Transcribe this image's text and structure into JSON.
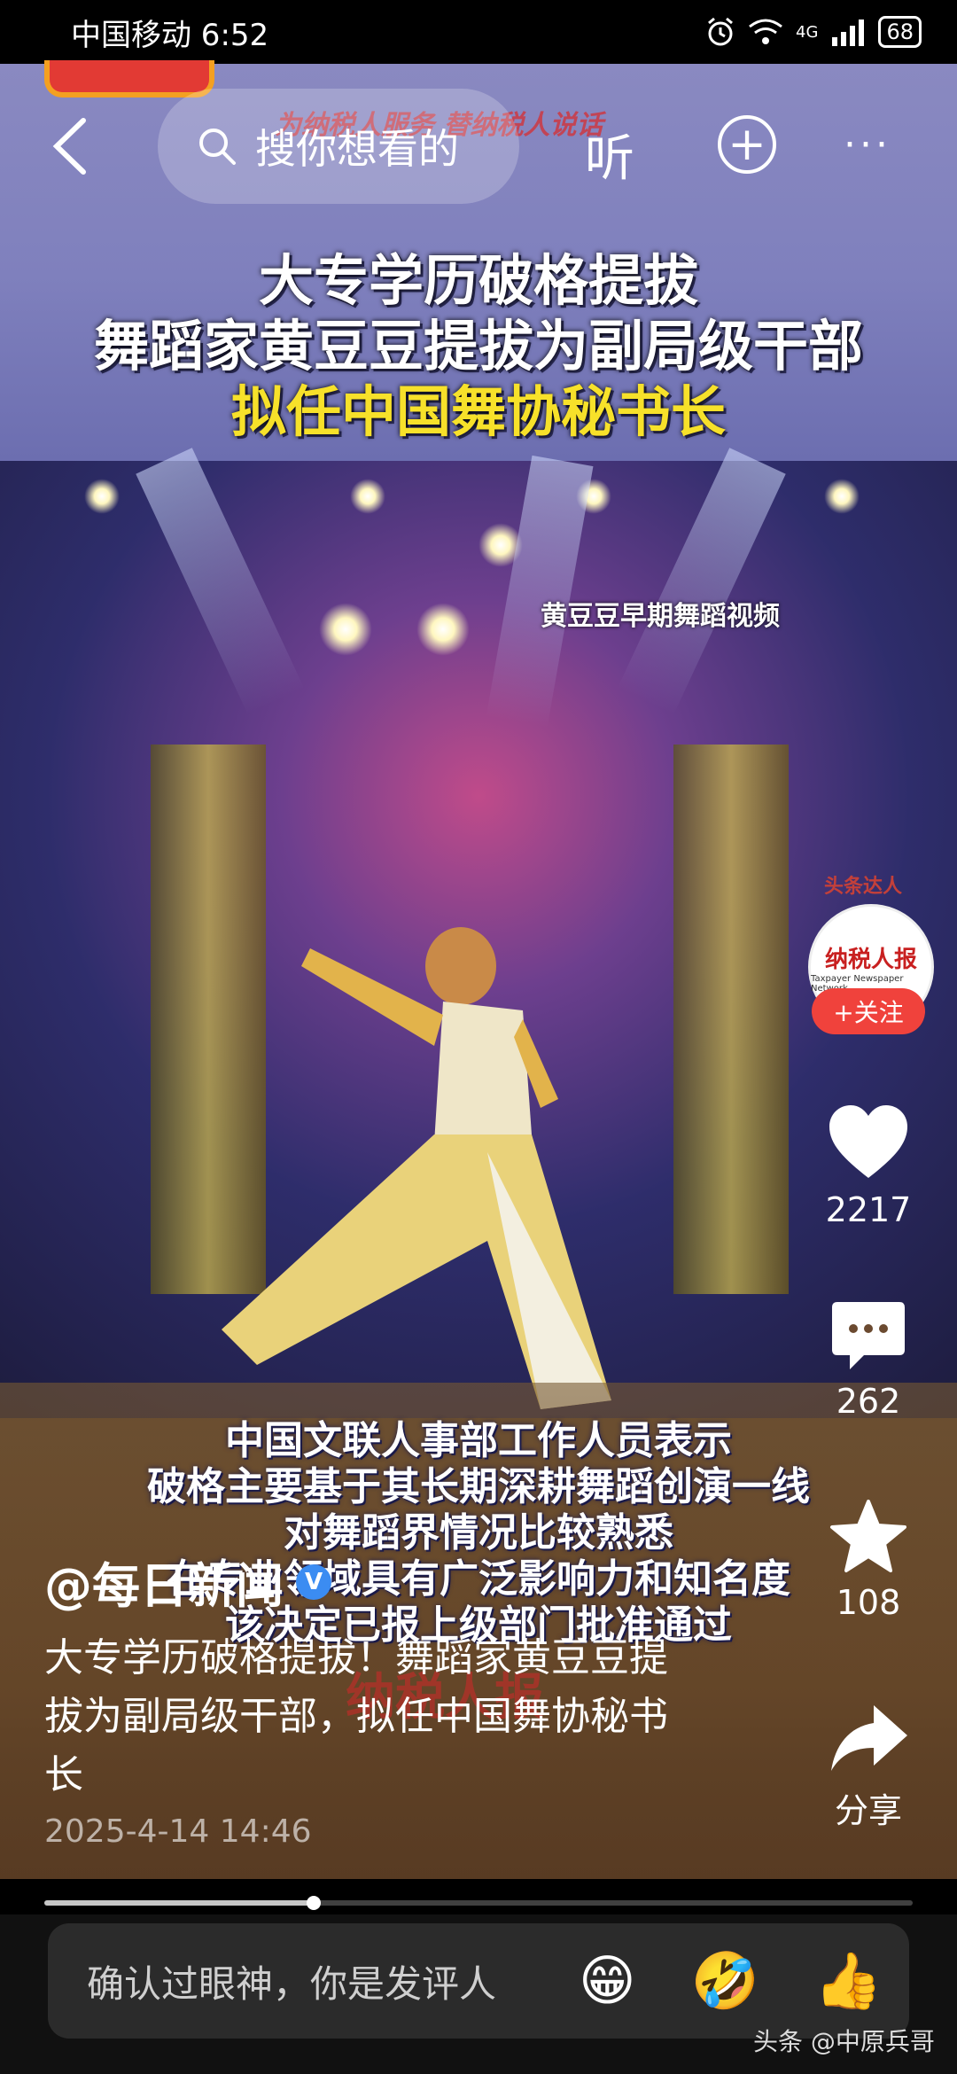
{
  "status_bar": {
    "carrier_time": "中国移动 6:52",
    "network": "4G",
    "battery": "68"
  },
  "top_nav": {
    "search_placeholder": "搜你想看的",
    "listen_label": "听",
    "plus_label": "+",
    "more_label": "···",
    "watermark": "为纳税人服务  替纳税人说话"
  },
  "video": {
    "headline": [
      "大专学历破格提拔",
      "舞蹈家黄豆豆提拔为副局级干部",
      "拟任中国舞协秘书长"
    ],
    "clip_note": "黄豆豆早期舞蹈视频",
    "subtitles": [
      "中国文联人事部工作人员表示",
      "破格主要基于其长期深耕舞蹈创演一线",
      "对舞蹈界情况比较熟悉",
      "在专业领域具有广泛影响力和知名度",
      "该决定已报上级部门批准通过"
    ],
    "bottom_watermark": "纳税人报",
    "progress": 0.31
  },
  "author": {
    "avatar_name": "纳税人报",
    "avatar_sub": "Taxpayer Newspaper Network",
    "badge": "头条达人",
    "follow_label": "+关注"
  },
  "actions": {
    "likes": "2217",
    "comments": "262",
    "favorites": "108",
    "share_label": "分享"
  },
  "post": {
    "author": "@每日新闻",
    "verified": "V",
    "text": "大专学历破格提拔！舞蹈家黄豆豆提拔为副局级干部，拟任中国舞协秘书长",
    "date": "2025-4-14 14:46"
  },
  "comment_bar": {
    "placeholder": "确认过眼神，你是发评人",
    "emojis": [
      "😁",
      "🤣",
      "👍"
    ]
  },
  "source_tag": "头条 @中原兵哥"
}
